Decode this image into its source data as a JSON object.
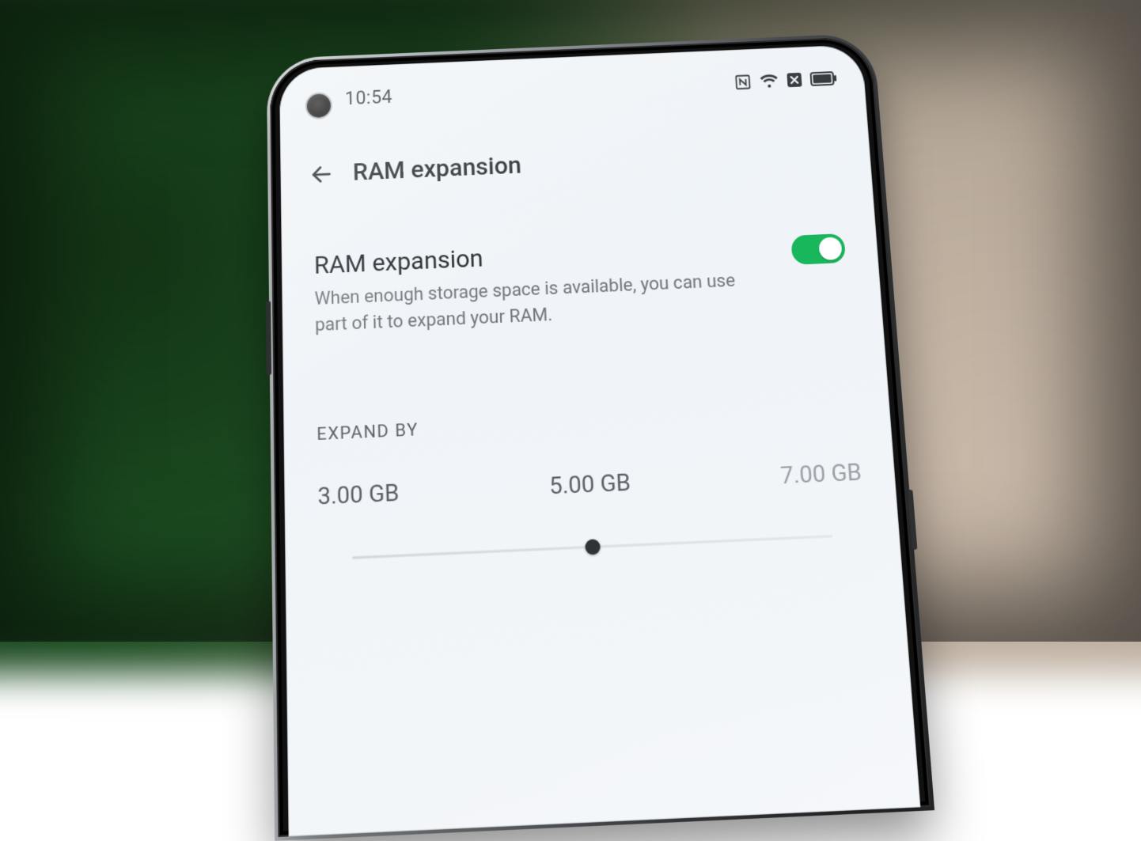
{
  "status": {
    "time": "10:54"
  },
  "header": {
    "title": "RAM expansion"
  },
  "setting": {
    "title": "RAM expansion",
    "description": "When enough storage space is available, you can use part of it to expand your RAM.",
    "enabled": true
  },
  "expand": {
    "label": "EXPAND BY",
    "options": [
      "3.00 GB",
      "5.00 GB",
      "7.00 GB"
    ],
    "selected_index": 1
  },
  "colors": {
    "accent": "#18b75c"
  }
}
